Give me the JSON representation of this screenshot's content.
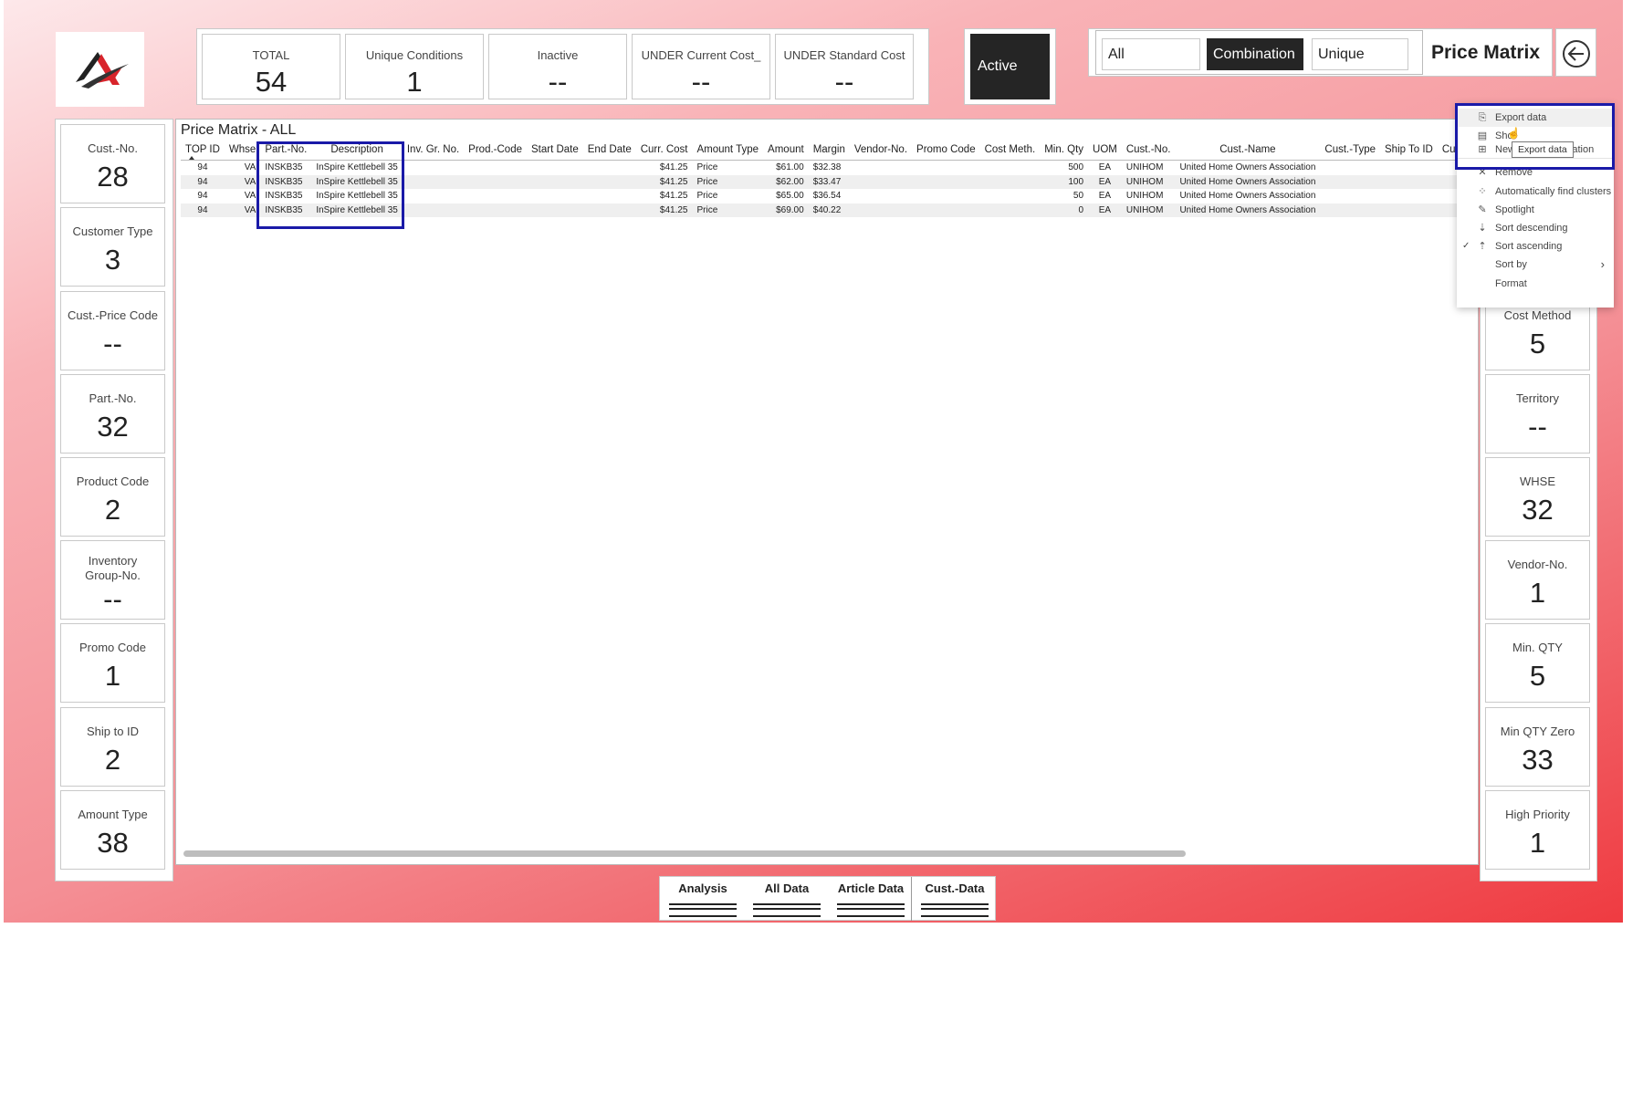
{
  "kpis": [
    {
      "label": "TOTAL",
      "value": "54"
    },
    {
      "label": "Unique Conditions",
      "value": "1"
    },
    {
      "label": "Inactive",
      "value": "--"
    },
    {
      "label": "UNDER Current Cost_",
      "value": "--"
    },
    {
      "label": "UNDER Standard Cost",
      "value": "--"
    }
  ],
  "status_button": "Active",
  "view_toggle": {
    "options": [
      "All",
      "Combination",
      "Unique"
    ],
    "selected": "Combination"
  },
  "page_title": "Price Matrix",
  "table": {
    "title": "Price Matrix - ALL",
    "columns": [
      "TOP ID",
      "Whse",
      "Part.-No.",
      "Description",
      "Inv. Gr. No.",
      "Prod.-Code",
      "Start Date",
      "End Date",
      "Curr. Cost",
      "Amount Type",
      "Amount",
      "Margin",
      "Vendor-No.",
      "Promo Code",
      "Cost Meth.",
      "Min. Qty",
      "UOM",
      "Cust.-No.",
      "Cust.-Name",
      "Cust.-Type",
      "Ship To ID",
      "Cust.-P"
    ],
    "rows": [
      [
        "94",
        "VA",
        "INSKB35",
        "InSpire Kettlebell 35",
        "",
        "",
        "",
        "",
        "$41.25",
        "Price",
        "$61.00",
        "$32.38",
        "",
        "",
        "",
        "500",
        "EA",
        "UNIHOM",
        "United Home Owners Association",
        "",
        "",
        ""
      ],
      [
        "94",
        "VA",
        "INSKB35",
        "InSpire Kettlebell 35",
        "",
        "",
        "",
        "",
        "$41.25",
        "Price",
        "$62.00",
        "$33.47",
        "",
        "",
        "",
        "100",
        "EA",
        "UNIHOM",
        "United Home Owners Association",
        "",
        "",
        ""
      ],
      [
        "94",
        "VA",
        "INSKB35",
        "InSpire Kettlebell 35",
        "",
        "",
        "",
        "",
        "$41.25",
        "Price",
        "$65.00",
        "$36.54",
        "",
        "",
        "",
        "50",
        "EA",
        "UNIHOM",
        "United Home Owners Association",
        "",
        "",
        ""
      ],
      [
        "94",
        "VA",
        "INSKB35",
        "InSpire Kettlebell 35",
        "",
        "",
        "",
        "",
        "$41.25",
        "Price",
        "$69.00",
        "$40.22",
        "",
        "",
        "",
        "0",
        "EA",
        "UNIHOM",
        "United Home Owners Association",
        "",
        "",
        ""
      ]
    ]
  },
  "left_cards": [
    {
      "label": "Cust.-No.",
      "value": "28"
    },
    {
      "label": "Customer Type",
      "value": "3"
    },
    {
      "label": "Cust.-Price Code",
      "value": "--"
    },
    {
      "label": "Part.-No.",
      "value": "32"
    },
    {
      "label": "Product Code",
      "value": "2"
    },
    {
      "label": "Inventory Group-No.",
      "value": "--"
    },
    {
      "label": "Promo Code",
      "value": "1"
    },
    {
      "label": "Ship to ID",
      "value": "2"
    },
    {
      "label": "Amount Type",
      "value": "38"
    }
  ],
  "right_cards": [
    {
      "label": "Cost Method",
      "value": "5"
    },
    {
      "label": "Territory",
      "value": "--"
    },
    {
      "label": "WHSE",
      "value": "32"
    },
    {
      "label": "Vendor-No.",
      "value": "1"
    },
    {
      "label": "Min. QTY",
      "value": "5"
    },
    {
      "label": "Min QTY Zero",
      "value": "33"
    },
    {
      "label": "High Priority",
      "value": "1"
    }
  ],
  "context_menu": {
    "items": [
      {
        "label": "Export data",
        "icon": "export-icon"
      },
      {
        "label": "Show as a table",
        "display": "Sho",
        "icon": "table-icon"
      },
      {
        "label": "New visual calculation",
        "icon": "calculation-icon"
      },
      {
        "label": "Remove",
        "icon": "close-icon"
      },
      {
        "label": "Automatically find clusters",
        "icon": "clusters-icon"
      },
      {
        "label": "Spotlight",
        "icon": "spotlight-icon"
      },
      {
        "label": "Sort descending",
        "icon": "sort-descending-icon"
      },
      {
        "label": "Sort ascending",
        "icon": "sort-ascending-icon",
        "checked": true
      },
      {
        "label": "Sort by",
        "icon": "",
        "submenu": true
      },
      {
        "label": "Format",
        "icon": ""
      }
    ],
    "tooltip": "Export data"
  },
  "bottom_tabs": [
    "Analysis",
    "All Data",
    "Article Data",
    "Cust.-Data"
  ],
  "colors": {
    "highlight": "#1a1aa8",
    "dark": "#252525",
    "gradient_end": "#ef3b41"
  }
}
